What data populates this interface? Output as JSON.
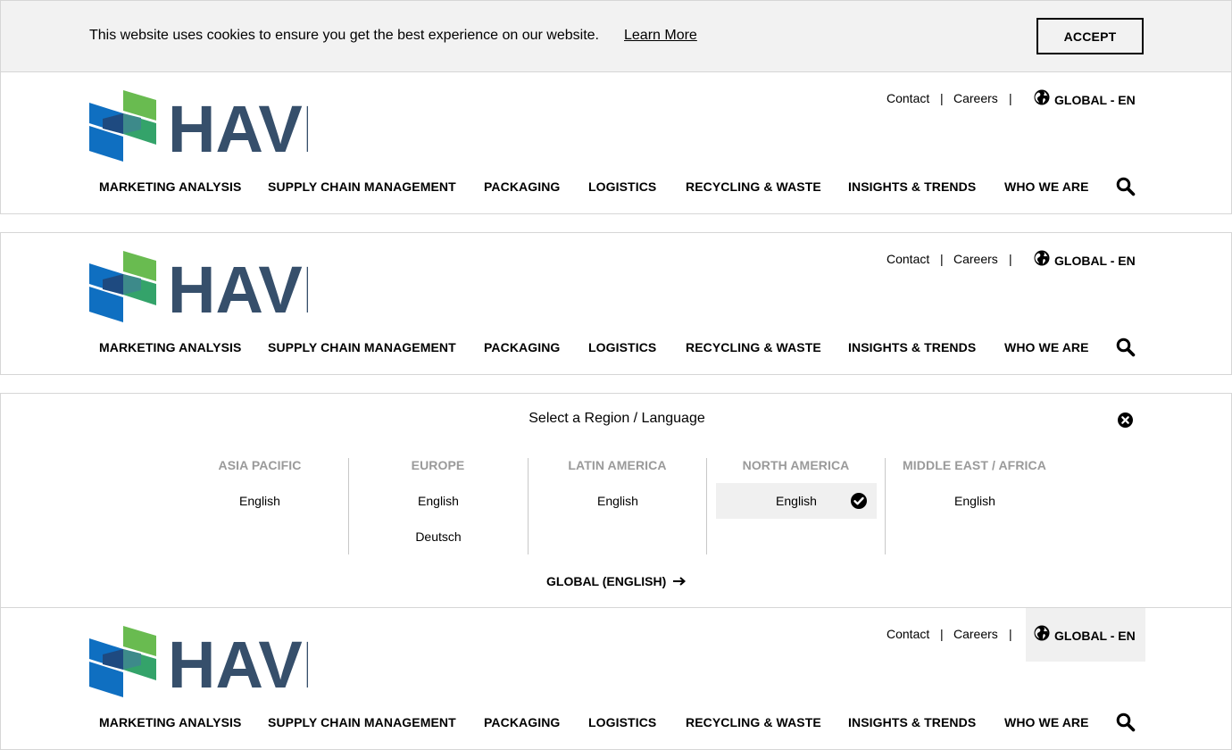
{
  "cookie": {
    "message": "This website uses cookies to ensure you get the best experience on our website.",
    "learn_more": "Learn More",
    "accept": "ACCEPT"
  },
  "brand": {
    "name": "HAVI",
    "colors": {
      "navy": "#364f6b",
      "blue": "#0f6fc1",
      "dark_blue": "#1e4a80",
      "green": "#69bb50",
      "teal": "#34a36a"
    }
  },
  "utility": {
    "contact": "Contact",
    "careers": "Careers",
    "separator": "|",
    "language": "GLOBAL - EN"
  },
  "nav": {
    "items": [
      "MARKETING ANALYSIS",
      "SUPPLY CHAIN MANAGEMENT",
      "PACKAGING",
      "LOGISTICS",
      "RECYCLING & WASTE",
      "INSIGHTS & TRENDS",
      "WHO WE ARE"
    ]
  },
  "region_selector": {
    "title": "Select a Region / Language",
    "regions": [
      {
        "name": "ASIA PACIFIC",
        "languages": [
          "English"
        ]
      },
      {
        "name": "EUROPE",
        "languages": [
          "English",
          "Deutsch"
        ]
      },
      {
        "name": "LATIN AMERICA",
        "languages": [
          "English"
        ]
      },
      {
        "name": "NORTH AMERICA",
        "languages": [
          "English"
        ],
        "selected": "English"
      },
      {
        "name": "MIDDLE EAST / AFRICA",
        "languages": [
          "English"
        ]
      }
    ],
    "global_link": "GLOBAL (ENGLISH)"
  },
  "icons": [
    "globe-icon",
    "search-icon",
    "close-icon",
    "check-icon",
    "arrow-right-icon"
  ]
}
